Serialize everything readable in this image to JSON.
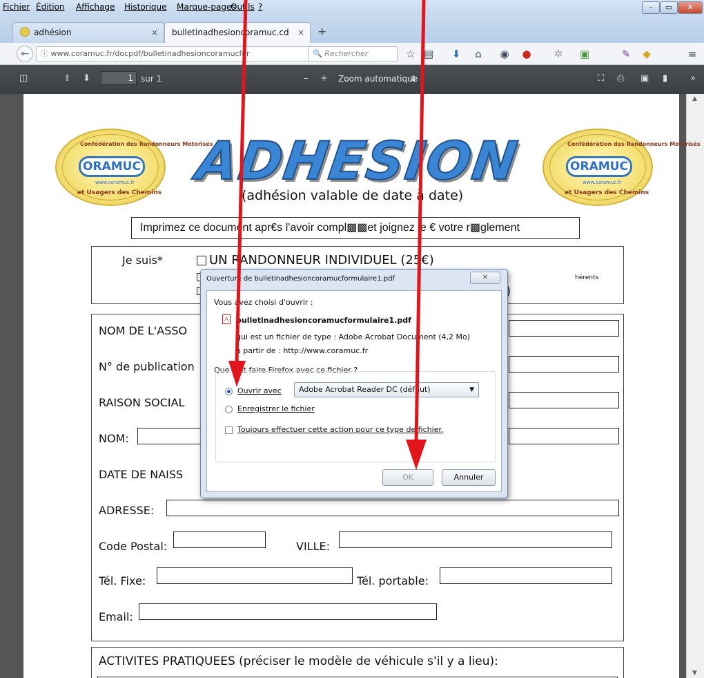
{
  "browser": {
    "menu": [
      "Fichier",
      "Édition",
      "Affichage",
      "Historique",
      "Marque-pages",
      "Outils",
      "?"
    ],
    "tabs": [
      {
        "label": "adhésion",
        "close": "×"
      },
      {
        "label": "bulletinadhesioncoramuc.cdr - b",
        "close": "×"
      }
    ],
    "new_tab": "+",
    "url": "www.coramuc.fr/docpdf/bulletinadhesioncoramucfor",
    "search_placeholder": "Rechercher",
    "window_buttons": [
      "–",
      "▭",
      "✕"
    ]
  },
  "pdf_toolbar": {
    "page_number": "1",
    "page_total": "sur 1",
    "zoom_minus": "–",
    "zoom_plus": "+",
    "zoom": "Zoom automatique"
  },
  "document": {
    "logo_left": {
      "name": "ORAMUC",
      "arc_top": "Confédération des Randonneurs Motorisés",
      "arc_bottom": "et Usagers des Chemins",
      "web": "www.coramuc.fr"
    },
    "logo_right": {
      "name": "ORAMUC",
      "arc_top": "Confédération des Randonneurs Motorisés",
      "arc_bottom": "et Usagers des Chemins",
      "web": "www.coramuc.fr"
    },
    "title": "ADHESION",
    "subtitle": "(adhésion valable de date à date)",
    "instruction": "Imprimez ce document apr€s l'avoir compl▩▩et joignez le € votre r▩glement",
    "je_suis": "Je suis*",
    "option1": "UN RANDONNEUR INDIVIDUEL (25€)",
    "option2_tail": "hérents",
    "option3_tail": ")",
    "fields": {
      "nom_asso": "NOM DE L'ASSO",
      "publication": "N° de publication",
      "raison": "RAISON SOCIAL",
      "nom": "NOM:",
      "date": "DATE DE NAISS",
      "adresse": "ADRESSE:",
      "code_postal": "Code Postal:",
      "ville": "VILLE:",
      "tel_fixe": "Tél. Fixe:",
      "tel_portable": "Tél. portable:",
      "email": "Email:"
    },
    "activites": "ACTIVITES PRATIQUEES (préciser le modèle de véhicule s'il y a lieu):"
  },
  "dialog": {
    "title": "Ouverture de bulletinadhesioncoramucformulaire1.pdf",
    "close": "✕",
    "intro": "Vous avez choisi d'ouvrir :",
    "filename": "bulletinadhesioncoramucformulaire1.pdf",
    "type_line": "qui est un fichier de type : Adobe Acrobat Document (4,2 Mo)",
    "from_line": "à partir de : http://www.coramuc.fr",
    "question": "Que doit faire Firefox avec ce fichier ?",
    "open_with": "Ouvrir avec",
    "app_select": "Adobe Acrobat Reader DC  (défaut)",
    "save": "Enregistrer le fichier",
    "always": "Toujours effectuer cette action pour ce type de fichier.",
    "ok": "OK",
    "cancel": "Annuler"
  },
  "colors": {
    "arrow": "#e0161c",
    "title_blue": "#3a86d4",
    "pdf_toolbar": "#424548"
  }
}
